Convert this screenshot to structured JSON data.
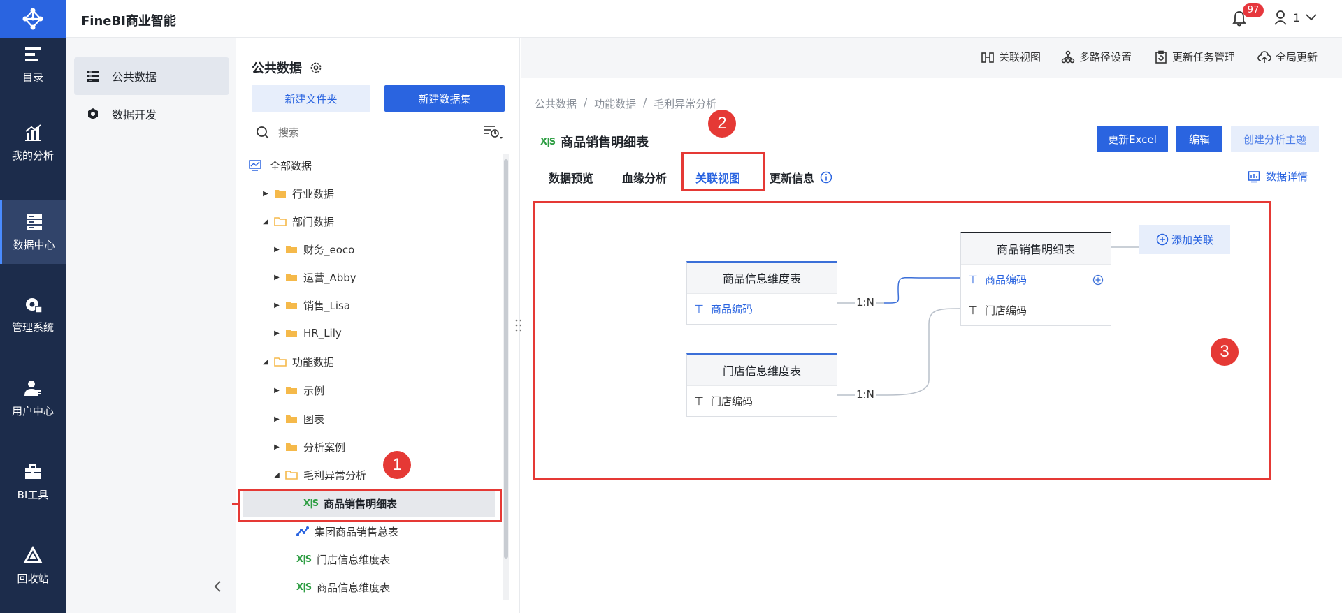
{
  "header": {
    "app_title": "FineBI商业智能",
    "notification_count": "97",
    "user_name": "1"
  },
  "leftnav": {
    "items": [
      {
        "label": "目录",
        "icon": "catalog-icon"
      },
      {
        "label": "我的分析",
        "icon": "analysis-icon"
      },
      {
        "label": "数据中心",
        "icon": "data-center-icon",
        "active": true
      },
      {
        "label": "管理系统",
        "icon": "management-icon"
      },
      {
        "label": "用户中心",
        "icon": "user-center-icon"
      },
      {
        "label": "BI工具",
        "icon": "bi-tools-icon"
      },
      {
        "label": "回收站",
        "icon": "recycle-icon"
      }
    ]
  },
  "col2": {
    "items": [
      {
        "label": "公共数据",
        "icon": "public-data-icon",
        "active": true
      },
      {
        "label": "数据开发",
        "icon": "data-dev-icon"
      }
    ]
  },
  "tree_panel": {
    "title": "公共数据",
    "new_folder": "新建文件夹",
    "new_dataset": "新建数据集",
    "search_placeholder": "搜索",
    "items": [
      {
        "label": "全部数据",
        "type": "root"
      },
      {
        "label": "行业数据",
        "type": "folder",
        "expanded": false
      },
      {
        "label": "部门数据",
        "type": "folder",
        "expanded": true
      },
      {
        "label": "财务_eoco",
        "type": "folder",
        "expanded": false
      },
      {
        "label": "运营_Abby",
        "type": "folder",
        "expanded": false
      },
      {
        "label": "销售_Lisa",
        "type": "folder",
        "expanded": false
      },
      {
        "label": "HR_Lily",
        "type": "folder",
        "expanded": false
      },
      {
        "label": "功能数据",
        "type": "folder",
        "expanded": true
      },
      {
        "label": "示例",
        "type": "folder",
        "expanded": false
      },
      {
        "label": "图表",
        "type": "folder",
        "expanded": false
      },
      {
        "label": "分析案例",
        "type": "folder",
        "expanded": false
      },
      {
        "label": "毛利异常分析",
        "type": "folder",
        "expanded": true
      },
      {
        "label": "商品销售明细表",
        "type": "excel",
        "selected": true
      },
      {
        "label": "集团商品销售总表",
        "type": "self-service"
      },
      {
        "label": "门店信息维度表",
        "type": "excel"
      },
      {
        "label": "商品信息维度表",
        "type": "excel"
      }
    ]
  },
  "toolbar": {
    "relation_view": "关联视图",
    "multi_path": "多路径设置",
    "update_task": "更新任务管理",
    "global_update": "全局更新"
  },
  "breadcrumb": [
    "公共数据",
    "/",
    "功能数据",
    "/",
    "毛利异常分析"
  ],
  "detail": {
    "file_badge": "X|S",
    "title": "商品销售明细表",
    "update_excel": "更新Excel",
    "edit": "编辑",
    "create_topic": "创建分析主题",
    "tabs": [
      "数据预览",
      "血缘分析",
      "关联视图",
      "更新信息"
    ],
    "data_detail": "数据详情"
  },
  "diagram": {
    "left_top": {
      "title": "商品信息维度表",
      "field": "商品编码"
    },
    "left_bottom": {
      "title": "门店信息维度表",
      "field": "门店编码"
    },
    "right": {
      "title": "商品销售明细表",
      "fields": [
        "商品编码",
        "门店编码"
      ]
    },
    "relation_1": "1:N",
    "relation_2": "1:N",
    "add_relation": "添加关联"
  },
  "annotations": [
    "1",
    "2",
    "3"
  ],
  "colors": {
    "primary": "#2a64e0",
    "nav_bg": "#1c2c4b",
    "highlight": "#e53935"
  }
}
